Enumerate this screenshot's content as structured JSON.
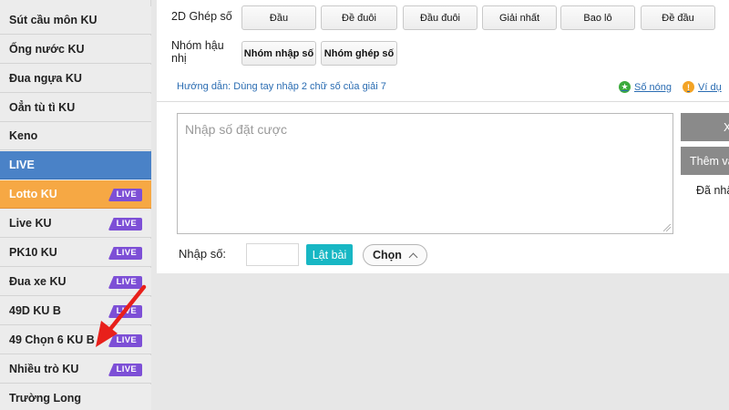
{
  "sidebar": {
    "items": [
      {
        "label": "Sút cầu môn KU",
        "badge": ""
      },
      {
        "label": "Ống nước KU",
        "badge": ""
      },
      {
        "label": "Đua ngựa KU",
        "badge": ""
      },
      {
        "label": "Oẳn tù tì KU",
        "badge": ""
      },
      {
        "label": "Keno",
        "badge": ""
      },
      {
        "label": "LIVE",
        "badge": ""
      },
      {
        "label": "Lotto KU",
        "badge": "LIVE"
      },
      {
        "label": "Live KU",
        "badge": "LIVE"
      },
      {
        "label": "PK10 KU",
        "badge": "LIVE"
      },
      {
        "label": "Đua xe KU",
        "badge": "LIVE"
      },
      {
        "label": "49D KU B",
        "badge": "LIVE"
      },
      {
        "label": "49 Chọn 6 KU B",
        "badge": "LIVE"
      },
      {
        "label": "Nhiều trò KU",
        "badge": "LIVE"
      },
      {
        "label": "Trường Long",
        "badge": ""
      }
    ]
  },
  "main": {
    "ghep_label": "2D Ghép số",
    "ghep_buttons": [
      "Đầu",
      "Đề đuôi",
      "Đầu đuôi",
      "Giải nhất",
      "Bao lô",
      "Đề đầu"
    ],
    "nhom_label_line1": "Nhóm hậu",
    "nhom_label_line2": "nhị",
    "nhom_buttons": [
      "Nhóm nhập số",
      "Nhóm ghép số"
    ],
    "guide": "Hướng dẫn:  Dùng tay nhập 2 chữ số của giải 7",
    "hot_link": "Số nóng",
    "example_link": "Ví dụ",
    "textarea_placeholder": "Nhập số đặt cược",
    "input_label": "Nhập số:",
    "flip_button": "Lật bài",
    "choose_button": "Chọn",
    "right_btn_1": "X",
    "right_btn_2": "Thêm và",
    "added_text": "Đã nhập"
  },
  "colors": {
    "section": "#4a82c7",
    "active": "#f6a844",
    "live_badge": "#7d4fd6",
    "flip_button": "#18b7c4",
    "arrow": "#e8201b"
  }
}
